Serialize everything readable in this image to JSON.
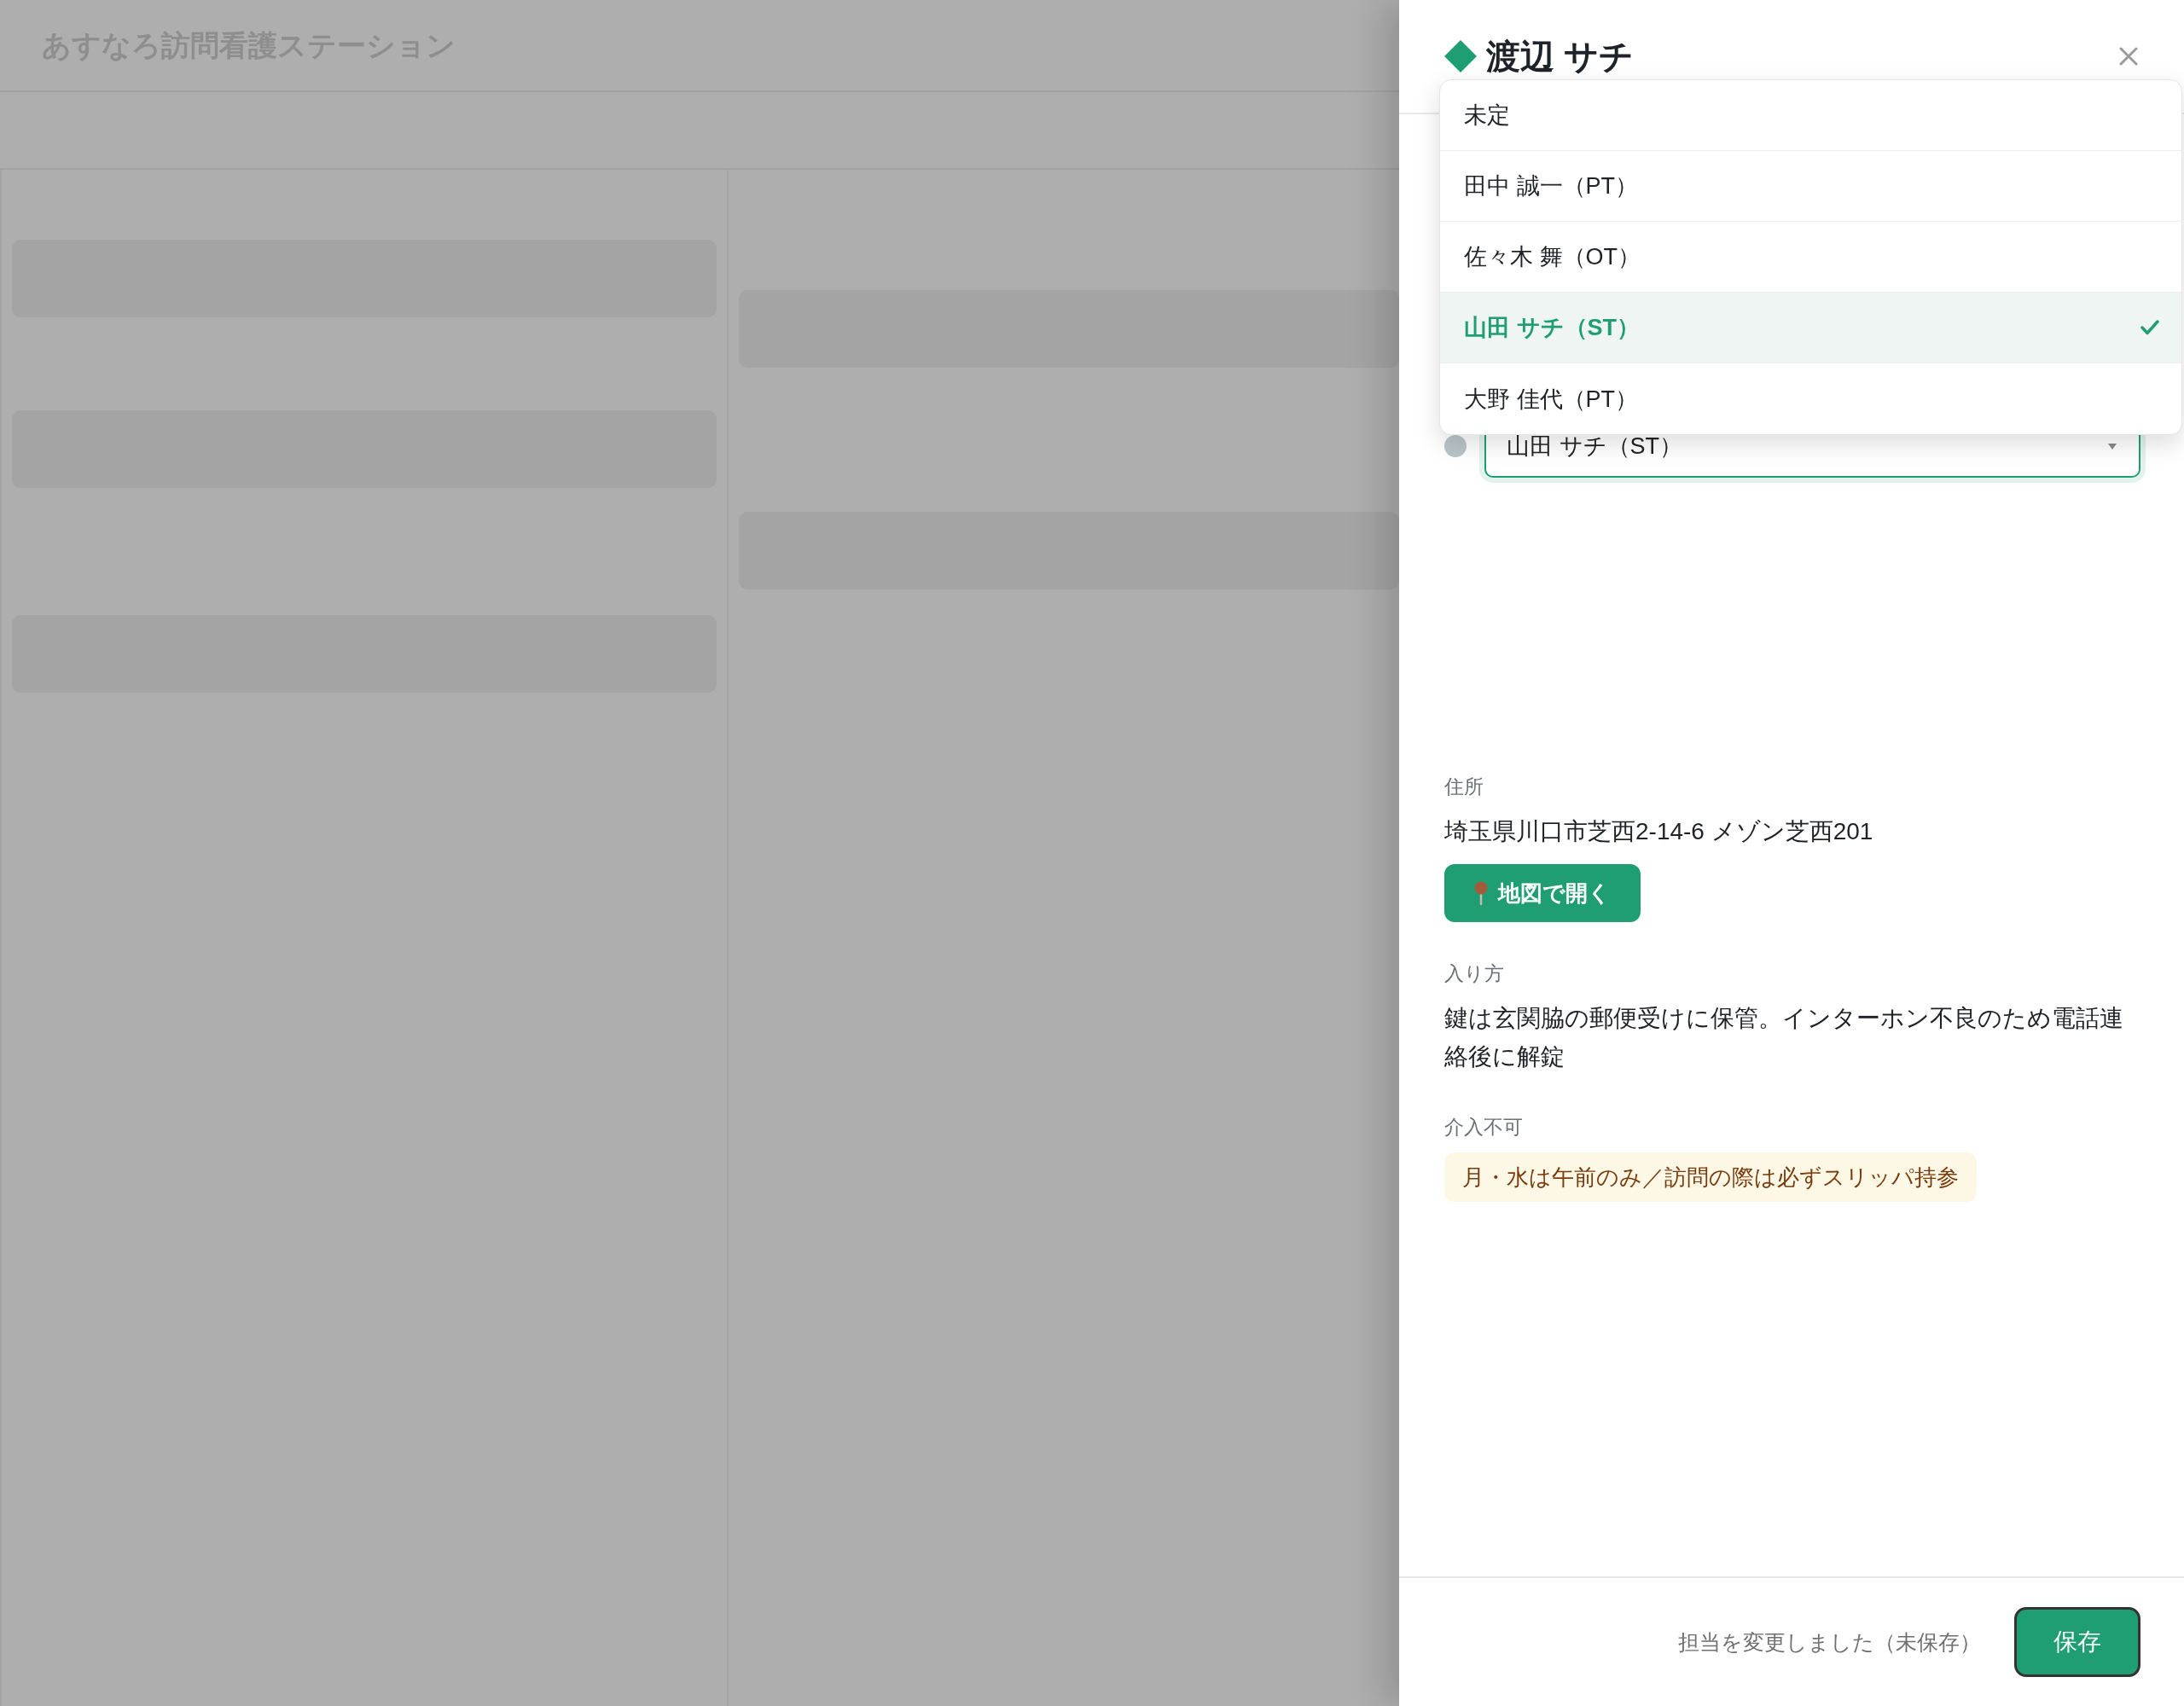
{
  "app": {
    "title": "あすなろ訪問看護ステーション"
  },
  "drawer": {
    "title": "渡辺 サチ",
    "assignee_select": {
      "value": "山田 サチ（ST）",
      "expanded": true,
      "options": [
        {
          "label": "未定",
          "selected": false
        },
        {
          "label": "田中 誠一（PT）",
          "selected": false
        },
        {
          "label": "佐々木 舞（OT）",
          "selected": false
        },
        {
          "label": "山田 サチ（ST）",
          "selected": true
        },
        {
          "label": "大野 佳代（PT）",
          "selected": false
        }
      ]
    },
    "sections": [
      {
        "label": "住所",
        "kind": "text",
        "text": "埼玉県川口市芝西2-14-6 メゾン芝西201",
        "button": "地図で開く"
      },
      {
        "label": "入り方",
        "kind": "text",
        "text": "鍵は玄関脇の郵便受けに保管。インターホン不良のため電話連絡後に解錠"
      },
      {
        "label": "介入不可",
        "kind": "warning",
        "text": "月・水は午前のみ／訪問の際は必ずスリッパ持参"
      }
    ],
    "footer": {
      "status": "担当を変更しました（未保存）",
      "save_button": "保存"
    }
  }
}
